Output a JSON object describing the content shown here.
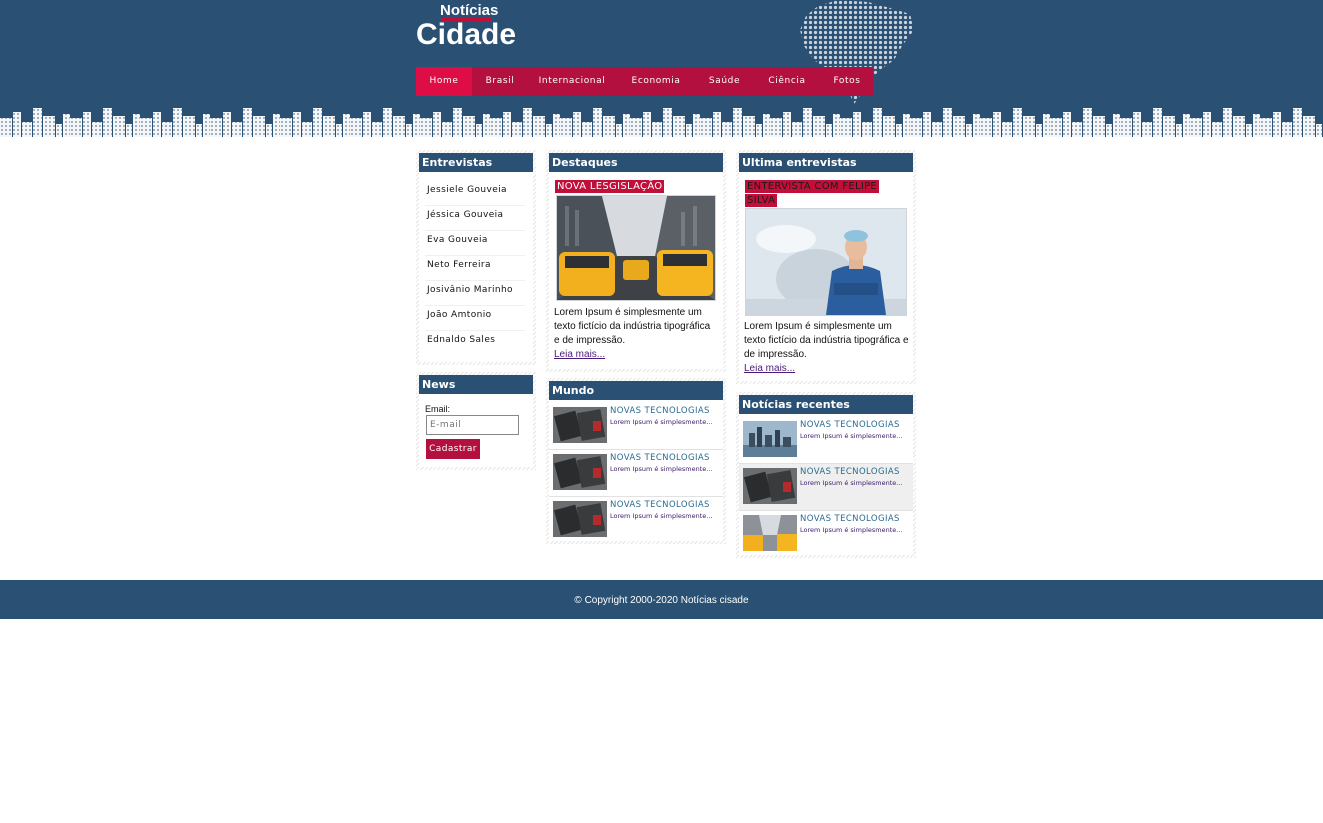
{
  "logo": {
    "small": "Notícias",
    "big": "Cidade"
  },
  "nav": [
    {
      "label": "Home",
      "active": true
    },
    {
      "label": "Brasil"
    },
    {
      "label": "Internacional"
    },
    {
      "label": "Economia"
    },
    {
      "label": "Saúde"
    },
    {
      "label": "Ciência"
    },
    {
      "label": "Fotos"
    }
  ],
  "entrevistas": {
    "title": "Entrevistas",
    "items": [
      "Jessiele Gouveia",
      "Jéssica Gouveia",
      "Eva Gouveia",
      "Neto Ferreira",
      "Josivânio Marinho",
      "João Amtonio",
      "Ednaldo Sales"
    ]
  },
  "news": {
    "title": "News",
    "email_label": "Email:",
    "email_placeholder": "E-mail",
    "button": "Cadastrar"
  },
  "destaques": {
    "title": "Destaques",
    "tag": "NOVA LESGISLAÇÃO",
    "text": "Lorem Ipsum é simplesmente um texto fictício da indústria tipográfica e de impressão.",
    "more": "Leia mais..."
  },
  "mundo": {
    "title": "Mundo",
    "items": [
      {
        "title": "NOVAS TECNOLOGIAS",
        "sub": "Lorem Ipsum é simplesmente..."
      },
      {
        "title": "NOVAS TECNOLOGIAS",
        "sub": "Lorem Ipsum é simplesmente..."
      },
      {
        "title": "NOVAS TECNOLOGIAS",
        "sub": "Lorem Ipsum é simplesmente..."
      }
    ]
  },
  "ultima": {
    "title": "Ultima entrevistas",
    "tag_line1": "ENTERVISTA COM FELIPE",
    "tag_line2": "SILVA",
    "text": "Lorem Ipsum é simplesmente um texto fictício da indústria tipográfica e de impressão.",
    "more": "Leia mais..."
  },
  "recentes": {
    "title": "Notícias recentes",
    "items": [
      {
        "title": "NOVAS TECNOLOGIAS",
        "sub": "Lorem Ipsum é simplesmente..."
      },
      {
        "title": "NOVAS TECNOLOGIAS",
        "sub": "Lorem Ipsum é simplesmente..."
      },
      {
        "title": "NOVAS TECNOLOGIAS",
        "sub": "Lorem Ipsum é simplesmente..."
      }
    ]
  },
  "footer": {
    "copyright": "© Copyright 2000-2020 Notícias cisade"
  },
  "colors": {
    "navy": "#2a5074",
    "crimson": "#b3103f",
    "active": "#de0d45"
  }
}
